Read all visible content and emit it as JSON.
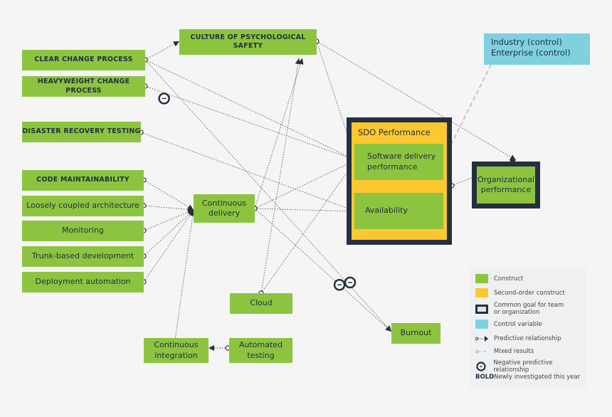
{
  "colors": {
    "construct": "#8cc440",
    "second_order": "#fdc82f",
    "goal": "#24303f",
    "control": "#7fd1e0",
    "line": "#555555"
  },
  "nodes": {
    "clear_change": "CLEAR CHANGE PROCESS",
    "heavyweight": "HEAVYWEIGHT CHANGE PROCESS",
    "disaster": "DISASTER RECOVERY TESTING",
    "code_maint": "CODE MAINTAINABILITY",
    "loosely": "Loosely coupled architecture",
    "monitoring": "Monitoring",
    "trunk": "Trunk-based development",
    "deploy": "Deployment automation",
    "culture": "CULTURE OF PSYCHOLOGICAL SAFETY",
    "cd": "Continuous delivery",
    "cloud": "Cloud",
    "ci": "Continuous integration",
    "auto_test": "Automated testing",
    "burnout": "Burnout",
    "sdo_title": "SDO Performance",
    "sdp": "Software delivery performance",
    "availability": "Availability",
    "org": "Organizational performance",
    "control_1": "Industry (control)",
    "control_2": "Enterprise (control)"
  },
  "edges": [
    {
      "from": "clear_change",
      "to": "culture",
      "type": "predictive"
    },
    {
      "from": "clear_change",
      "to": "sdp",
      "type": "predictive"
    },
    {
      "from": "clear_change",
      "to": "burnout",
      "type": "predictive"
    },
    {
      "from": "heavyweight",
      "to": "sdp",
      "type": "negative"
    },
    {
      "from": "disaster",
      "to": "availability",
      "type": "predictive"
    },
    {
      "from": "code_maint",
      "to": "cd",
      "type": "predictive"
    },
    {
      "from": "loosely",
      "to": "cd",
      "type": "predictive"
    },
    {
      "from": "monitoring",
      "to": "cd",
      "type": "predictive"
    },
    {
      "from": "trunk",
      "to": "cd",
      "type": "predictive"
    },
    {
      "from": "deploy",
      "to": "cd",
      "type": "predictive"
    },
    {
      "from": "cd",
      "to": "culture",
      "type": "predictive"
    },
    {
      "from": "cd",
      "to": "sdp",
      "type": "predictive"
    },
    {
      "from": "cd",
      "to": "availability",
      "type": "predictive"
    },
    {
      "from": "cd",
      "to": "burnout",
      "type": "negative"
    },
    {
      "from": "culture",
      "to": "sdp",
      "type": "predictive"
    },
    {
      "from": "culture",
      "to": "org",
      "type": "predictive"
    },
    {
      "from": "cloud",
      "to": "sdp",
      "type": "predictive"
    },
    {
      "from": "cloud",
      "to": "culture",
      "type": "predictive"
    },
    {
      "from": "ci",
      "to": "cd",
      "type": "predictive"
    },
    {
      "from": "auto_test",
      "to": "ci",
      "type": "predictive"
    },
    {
      "from": "sdo",
      "to": "org",
      "type": "predictive"
    },
    {
      "from": "control",
      "to": "sdp",
      "type": "mixed"
    }
  ],
  "legend": {
    "construct": "Construct",
    "second_order": "Second-order construct",
    "goal": "Common goal for team or organization",
    "control": "Control variable",
    "predictive": "Predictive relationship",
    "mixed": "Mixed results",
    "negative": "Negative predictive relationship",
    "bold_key": "BOLD",
    "bold": "Newly investigated this year"
  }
}
